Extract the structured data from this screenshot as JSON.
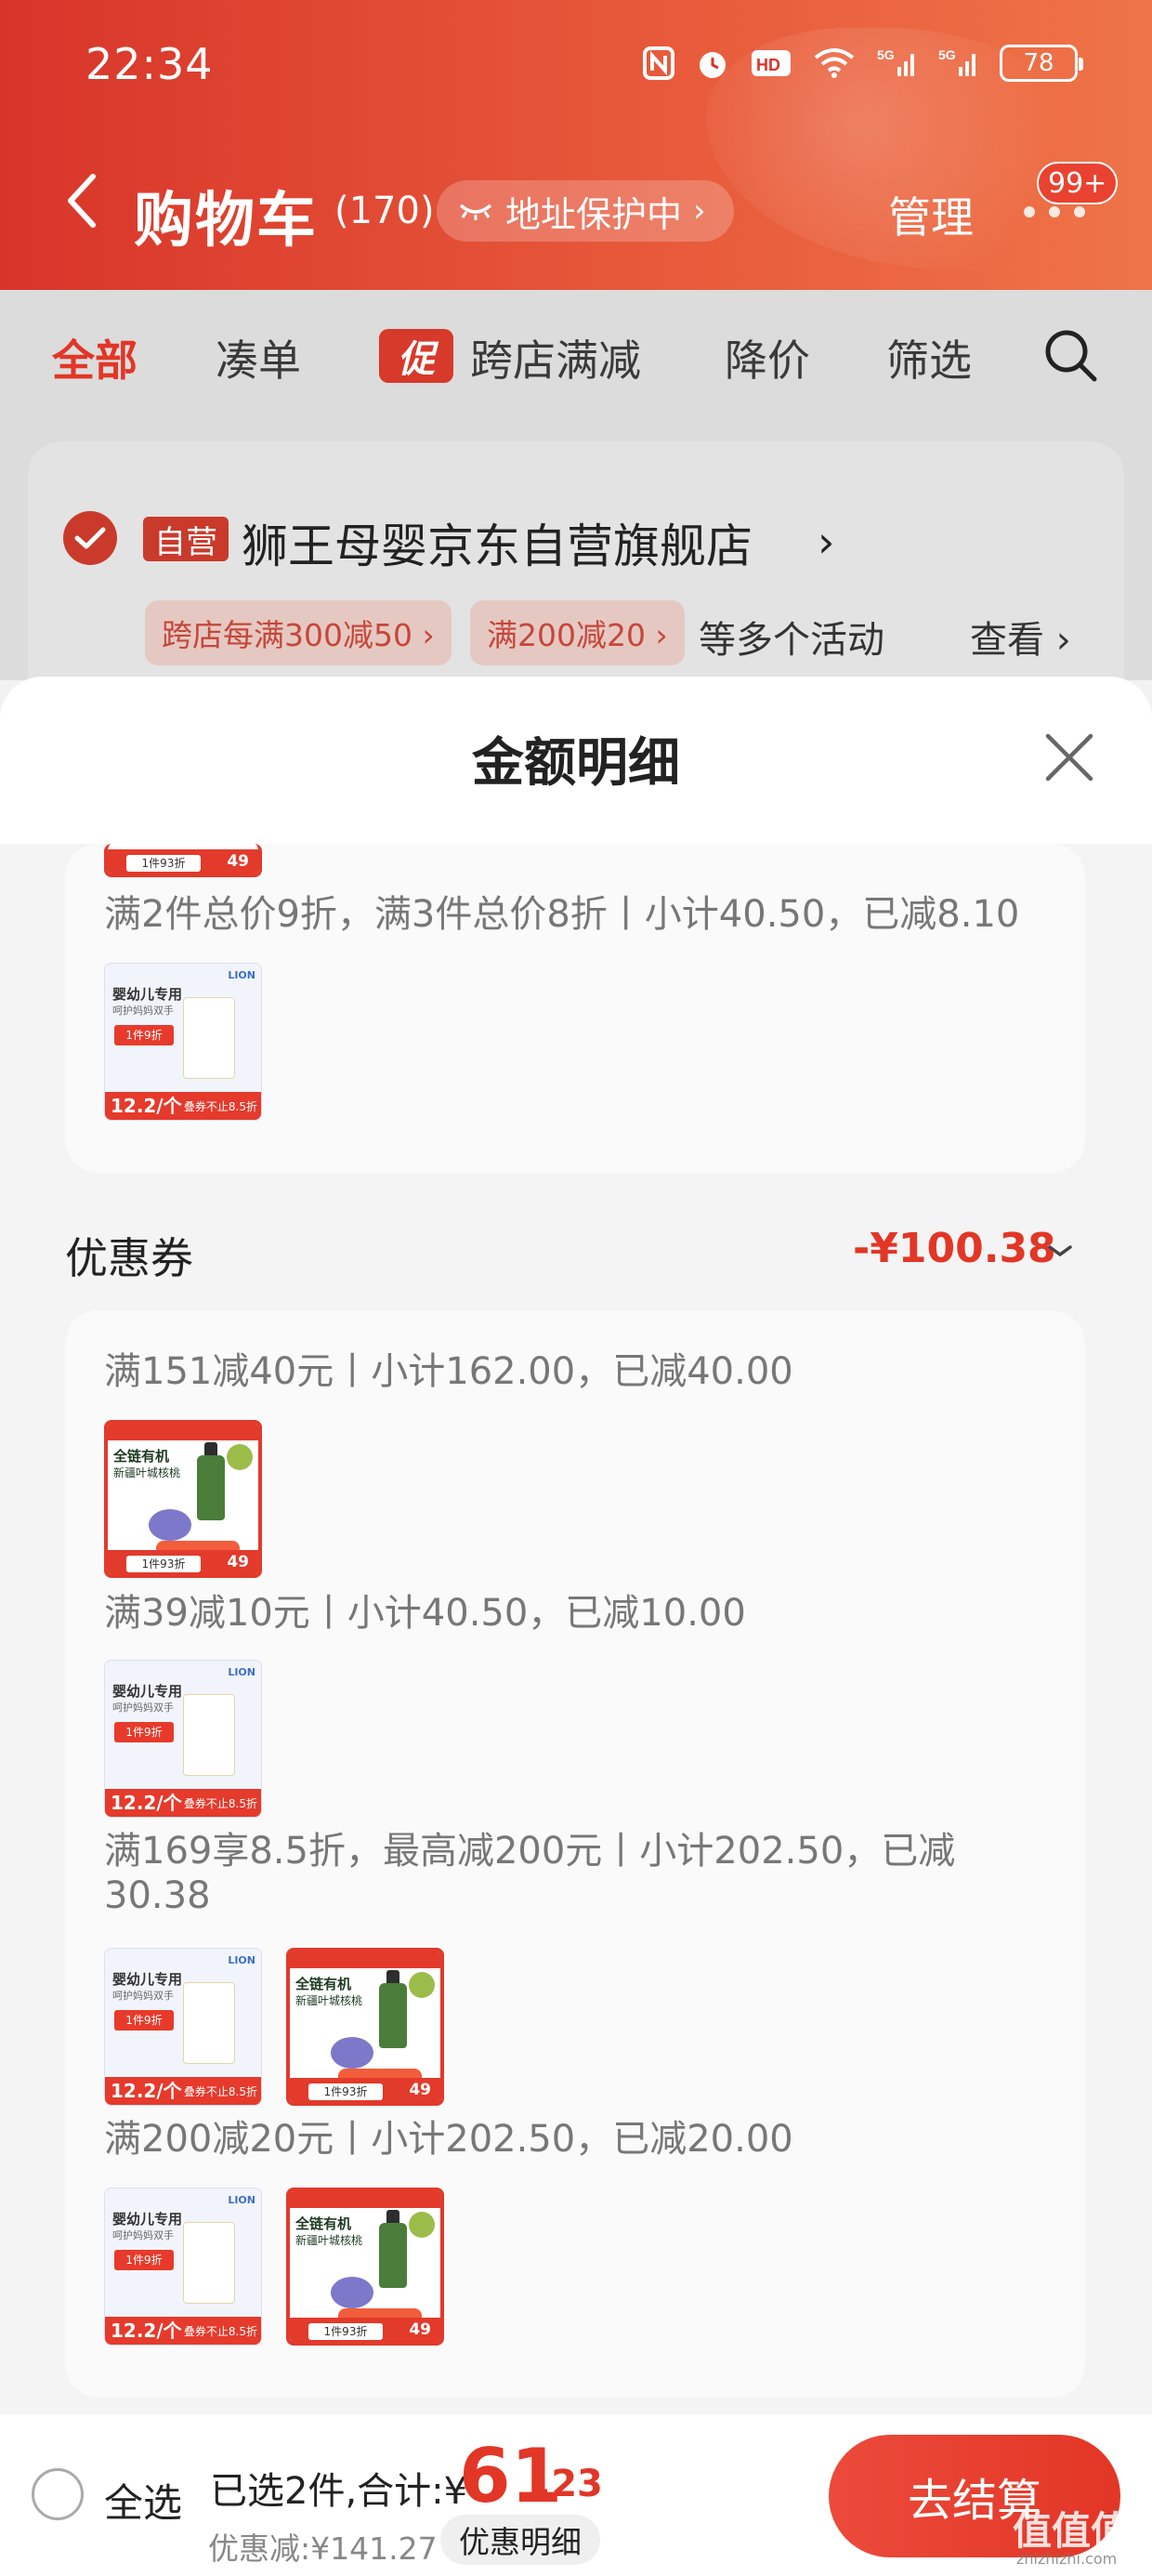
{
  "status_bar": {
    "time": "22:34",
    "battery": "78",
    "icons": [
      "nfc-icon",
      "alarm-icon",
      "hd-icon",
      "wifi-icon",
      "signal-5g-icon",
      "signal-5g-icon"
    ]
  },
  "header": {
    "title": "购物车",
    "count": "(170)",
    "address_protection": "地址保护中",
    "manage": "管理",
    "more_badge": "99+"
  },
  "tabs": {
    "all": "全部",
    "bundle": "凑单",
    "promo_tag": "促",
    "cross_store": "跨店满减",
    "price_drop": "降价",
    "filter": "筛选"
  },
  "store": {
    "self_tag": "自营",
    "name": "狮王母婴京东自营旗舰店",
    "promos": [
      "跨店每满300减50 ›",
      "满200减20 ›"
    ],
    "more_activities": "等多个活动",
    "view": "查看 ›"
  },
  "sheet": {
    "title": "金额明细",
    "discount_rule_top": "满2件总价9折，满3件总价8折丨小计40.50，已减8.10",
    "coupons": {
      "label": "优惠券",
      "amount": "-¥100.38",
      "rules": [
        "满151减40元丨小计162.00，已减40.00",
        "满39减10元丨小计40.50，已减10.00",
        "满169享8.5折，最高减200元丨小计202.50，已减30.38",
        "满200减20元丨小计202.50，已减20.00"
      ]
    },
    "product_lion": {
      "brand": "LION",
      "title": "婴幼儿专用",
      "subtitle": "呵护妈妈双手",
      "deal": "1件9折",
      "price": "12.2/个",
      "coupon": "叠券不止8.5折"
    },
    "product_oil": {
      "title": "全链有机",
      "subtitle": "新疆叶城核桃",
      "deal": "1件93折",
      "price": "49"
    }
  },
  "bottom": {
    "select_all": "全选",
    "selected": "已选2件,合计:¥",
    "total_int": "61",
    "total_dec": ".23",
    "discount": "优惠减:¥141.27",
    "detail": "优惠明细",
    "checkout": "去结算",
    "watermark": "值值值",
    "watermark_sub": "zhizhizhi.com"
  },
  "colors": {
    "brand_red": "#e23626",
    "header_red": "#d8352a"
  }
}
